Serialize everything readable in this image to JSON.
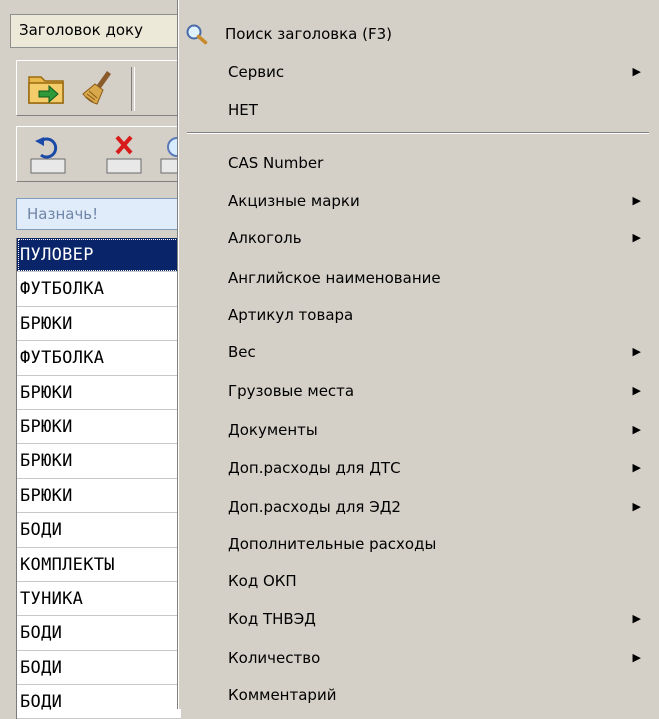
{
  "left_pane": {
    "column_header": "Заголовок доку",
    "filter_placeholder": "Назначь!",
    "rows": [
      "ПУЛОВЕР",
      "ФУТБОЛКА",
      "БРЮКИ",
      "ФУТБОЛКА",
      "БРЮКИ",
      "БРЮКИ",
      "БРЮКИ",
      "БРЮКИ",
      "БОДИ",
      "КОМПЛЕКТЫ",
      "ТУНИКА",
      "БОДИ",
      "БОДИ",
      "БОДИ"
    ],
    "selected_row": 0,
    "toolbar_icons": [
      "folder-import-icon",
      "broom-icon",
      "undo-icon",
      "delete-icon",
      "search-icon"
    ]
  },
  "menu": {
    "items": [
      {
        "label": "Поиск заголовка (F3)",
        "submenu": false,
        "icon": "search-icon"
      },
      {
        "label": "Сервис",
        "submenu": true
      },
      {
        "label": "НЕТ",
        "submenu": false
      },
      {
        "label": "CAS Number",
        "submenu": false
      },
      {
        "label": "Акцизные марки",
        "submenu": true
      },
      {
        "label": "Алкоголь",
        "submenu": true
      },
      {
        "label": "Английское наименование",
        "submenu": false
      },
      {
        "label": "Артикул товара",
        "submenu": false
      },
      {
        "label": "Вес",
        "submenu": true
      },
      {
        "label": "Грузовые места",
        "submenu": true
      },
      {
        "label": "Документы",
        "submenu": true
      },
      {
        "label": "Доп.расходы для ДТС",
        "submenu": true
      },
      {
        "label": "Доп.расходы для ЭД2",
        "submenu": true
      },
      {
        "label": "Дополнительные расходы",
        "submenu": false
      },
      {
        "label": "Код ОКП",
        "submenu": false
      },
      {
        "label": "Код ТНВЭД",
        "submenu": true
      },
      {
        "label": "Количество",
        "submenu": true
      },
      {
        "label": "Комментарий",
        "submenu": false
      }
    ],
    "submenu_arrow": "▶"
  },
  "colors": {
    "window_bg": "#d4d0c8",
    "selection_bg": "#0a246a",
    "filter_bg": "#e0ecfa"
  }
}
